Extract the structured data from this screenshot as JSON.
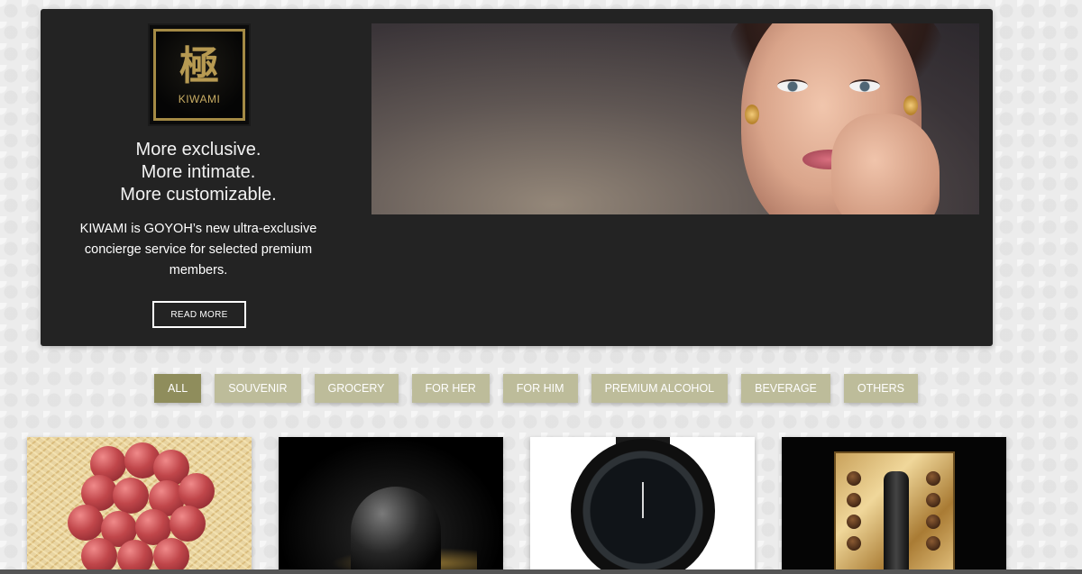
{
  "banner": {
    "logo": {
      "kanji": "極",
      "word": "KIWAMI"
    },
    "tagline": [
      "More exclusive.",
      "More intimate.",
      "More customizable."
    ],
    "description": "KIWAMI is GOYOH’s new ultra-exclusive concierge service for selected premium members.",
    "cta_label": "READ MORE"
  },
  "filters": {
    "active": "ALL",
    "items": [
      "ALL",
      "SOUVENIR",
      "GROCERY",
      "FOR HER",
      "FOR HIM",
      "PREMIUM ALCOHOL",
      "BEVERAGE",
      "OTHERS"
    ]
  },
  "products": [
    {
      "image": "red-grapes-photo"
    },
    {
      "image": "black-diffuser-photo"
    },
    {
      "image": "chronograph-watch-photo"
    },
    {
      "image": "gift-set-photo"
    }
  ],
  "colors": {
    "banner_bg": "#232323",
    "filter_bg": "#bdbc9a",
    "filter_active_bg": "#8f8d5c",
    "logo_gold": "#b79a52"
  }
}
